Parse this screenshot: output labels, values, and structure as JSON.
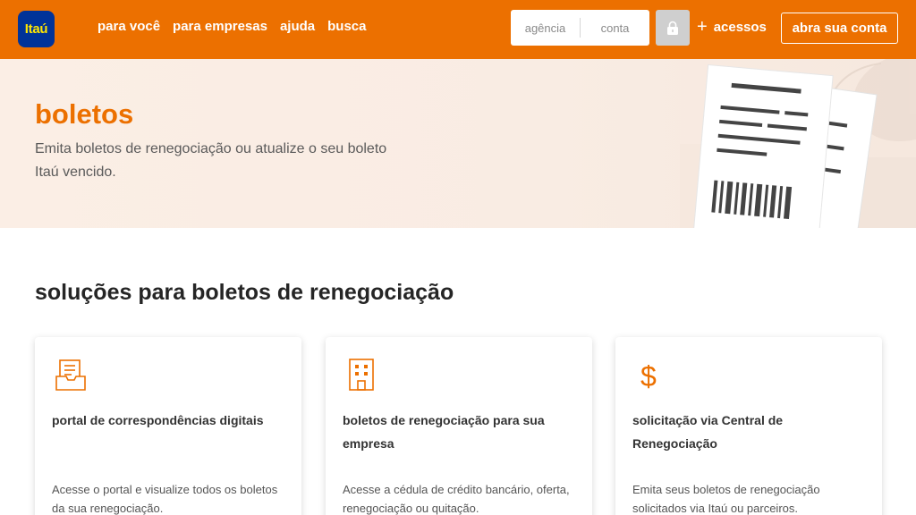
{
  "header": {
    "logo_text": "Itaú",
    "nav": [
      "para você",
      "para empresas",
      "ajuda",
      "busca"
    ],
    "login": {
      "agency_placeholder": "agência",
      "account_placeholder": "conta"
    },
    "access_label": "acessos",
    "open_account_label": "abra sua conta"
  },
  "hero": {
    "title": "boletos",
    "subtitle": "Emita boletos de renegociação ou atualize o seu boleto Itaú vencido."
  },
  "section": {
    "title": "soluções para boletos de renegociação",
    "cards": [
      {
        "icon": "document-tray-icon",
        "title": "portal de correspondências digitais",
        "description": "Acesse o portal e visualize todos os boletos da sua renegociação."
      },
      {
        "icon": "building-icon",
        "title": "boletos de renegociação para sua empresa",
        "description": "Acesse a cédula de crédito bancário, oferta, renegociação ou quitação."
      },
      {
        "icon": "dollar-icon",
        "title": "solicitação via Central de Renegociação",
        "description": "Emita seus boletos de renegociação solicitados via Itaú ou parceiros."
      }
    ]
  },
  "colors": {
    "brand_orange": "#ec7000",
    "brand_blue": "#003399",
    "logo_yellow": "#ffe600",
    "hero_bg": "#fbeee5"
  }
}
